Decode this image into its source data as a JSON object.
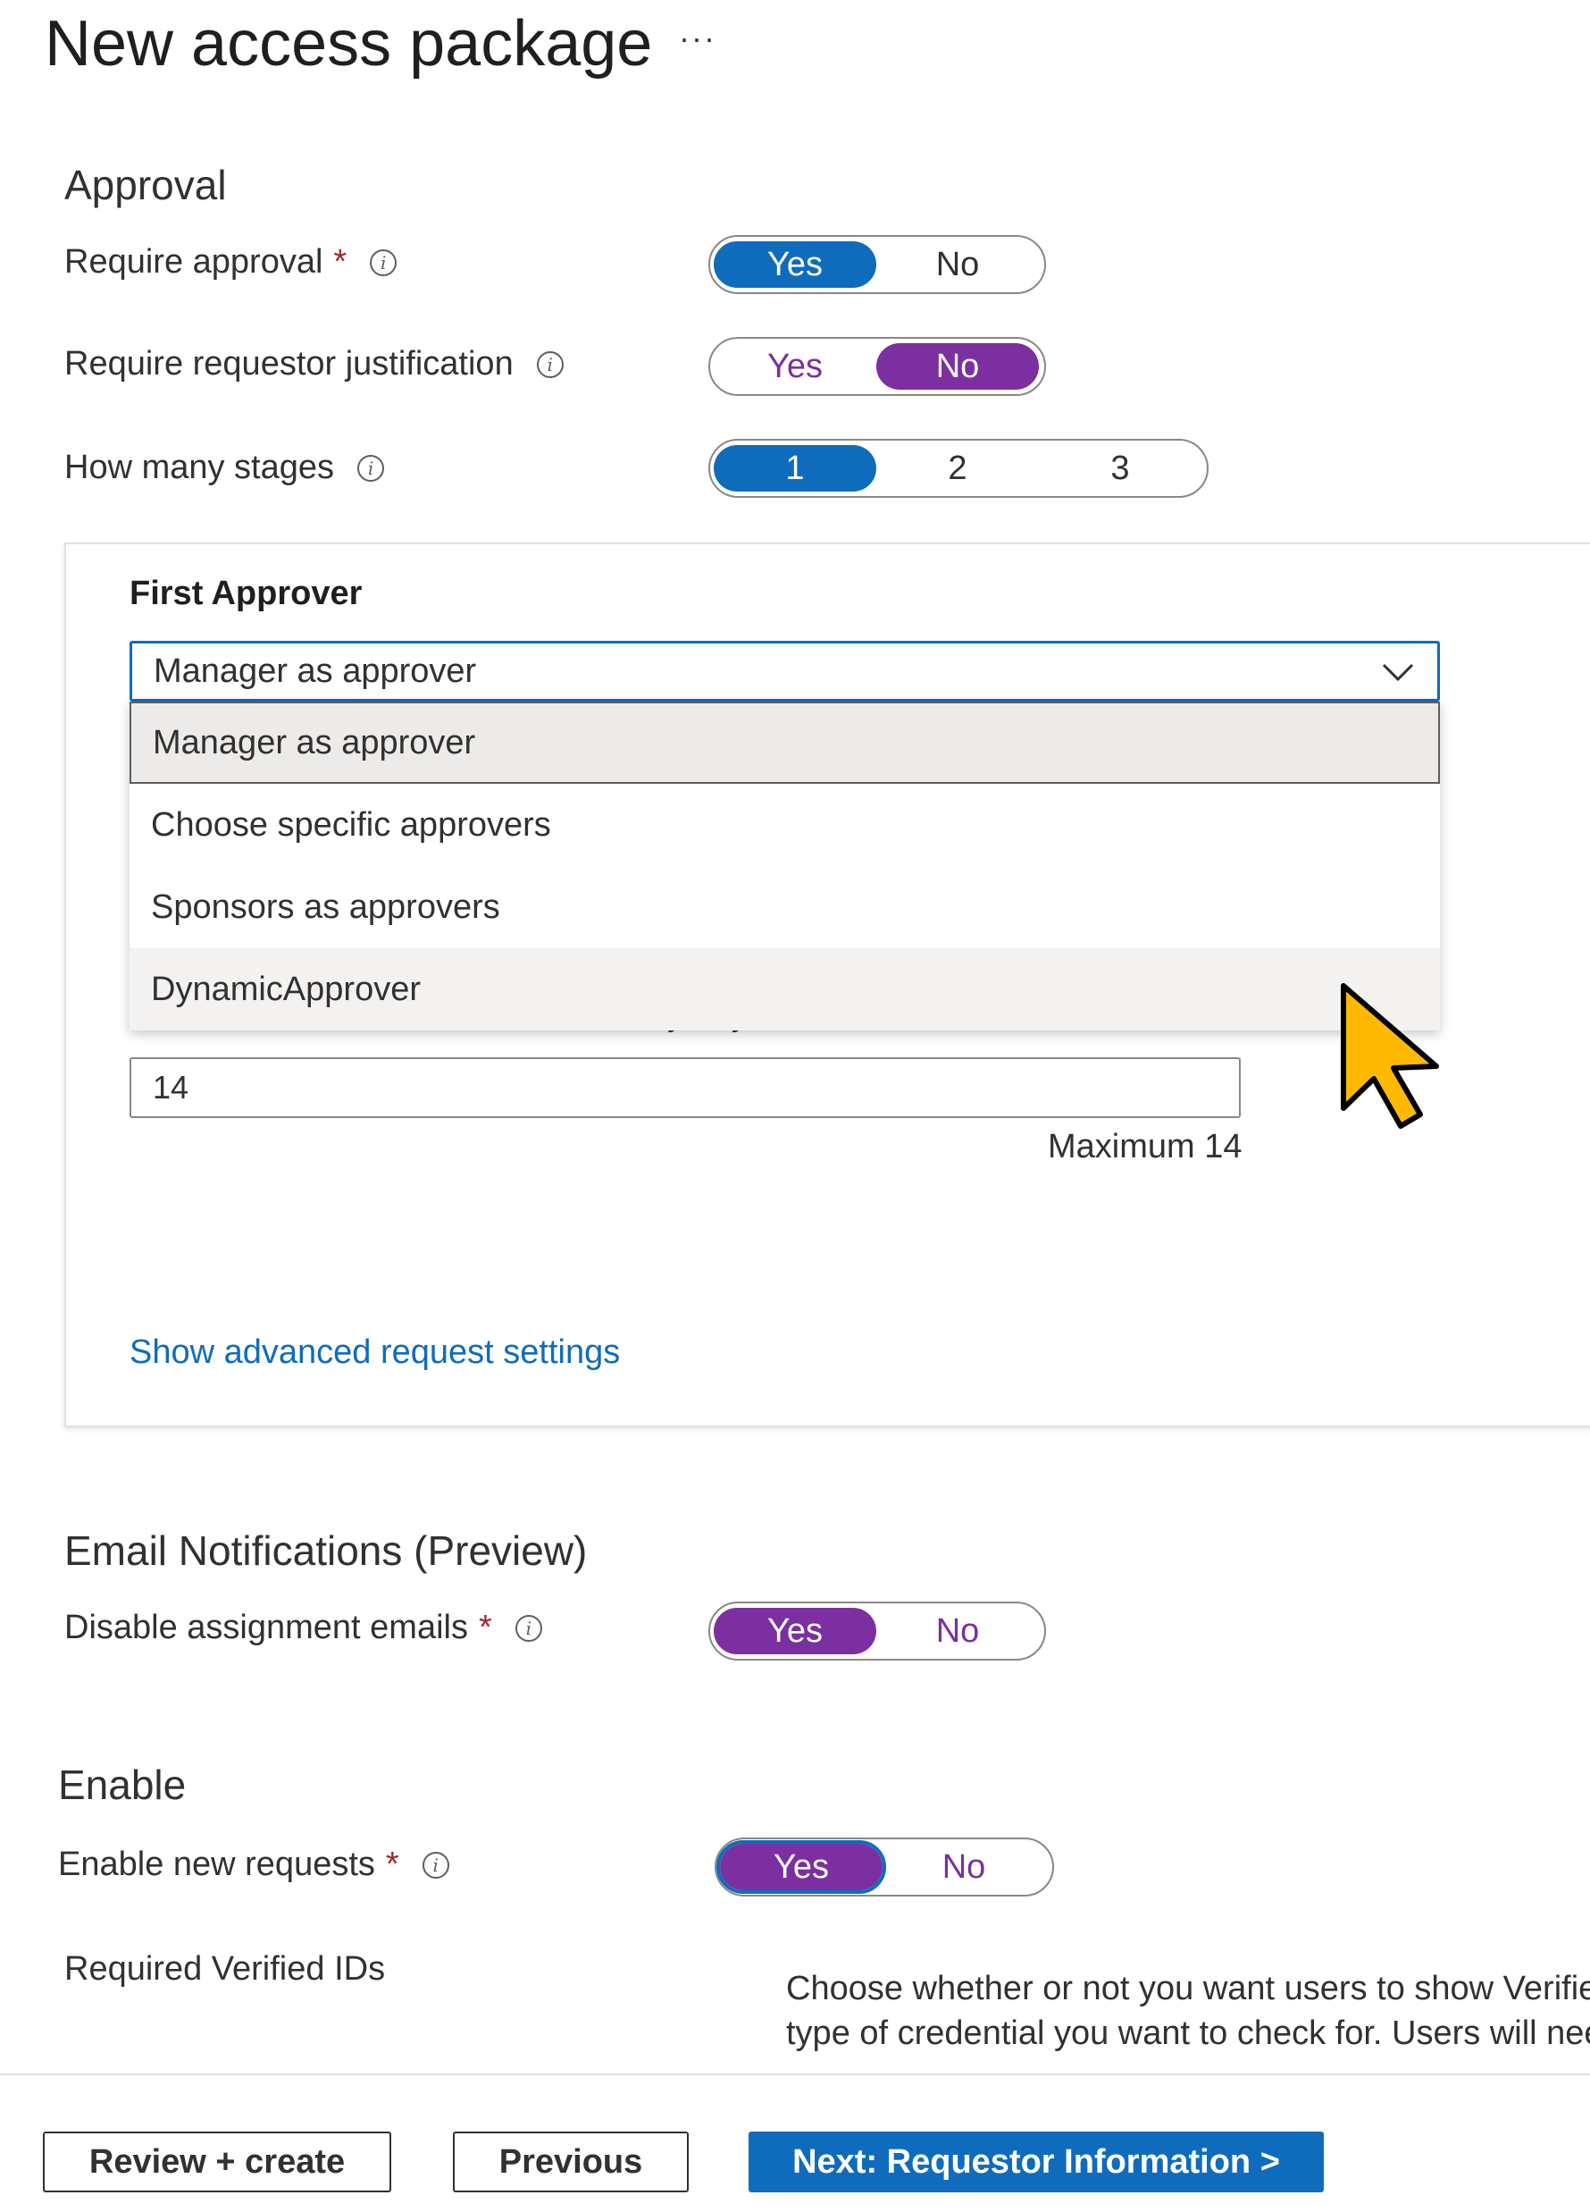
{
  "page": {
    "title": "New access package",
    "more_label": "···"
  },
  "approval": {
    "heading": "Approval",
    "require_approval": {
      "label": "Require approval",
      "required_mark": "*",
      "yes": "Yes",
      "no": "No",
      "selected": "Yes"
    },
    "require_justification": {
      "label": "Require requestor justification",
      "yes": "Yes",
      "no": "No",
      "selected": "No"
    },
    "stages": {
      "label": "How many stages",
      "options": [
        "1",
        "2",
        "3"
      ],
      "selected": "1"
    },
    "first_approver": {
      "label": "First Approver",
      "value": "Manager as approver",
      "options": [
        "Manager as approver",
        "Choose specific approvers",
        "Sponsors as approvers",
        "DynamicApprover"
      ],
      "selected_index": 0,
      "hovered_index": 3
    },
    "decision_days": {
      "label": "Decision must be made in how many days?",
      "value": "14",
      "max_text": "Maximum 14"
    },
    "advanced_link": "Show advanced request settings"
  },
  "email": {
    "heading": "Email Notifications (Preview)",
    "disable_emails": {
      "label": "Disable assignment emails",
      "required_mark": "*",
      "yes": "Yes",
      "no": "No",
      "selected": "Yes"
    }
  },
  "enable": {
    "heading": "Enable",
    "new_requests": {
      "label": "Enable new requests",
      "required_mark": "*",
      "yes": "Yes",
      "no": "No",
      "selected": "Yes"
    },
    "verified_ids": {
      "label": "Required Verified IDs",
      "hint_line1": "Choose whether or not you want users to show Verified",
      "hint_line2": "type of credential you want to check for. Users will nee"
    }
  },
  "footer": {
    "review_create": "Review + create",
    "previous": "Previous",
    "next": "Next: Requestor Information >"
  },
  "colors": {
    "primary_blue": "#0f6cbd",
    "purple": "#7b2fa0",
    "required_red": "#a4262c",
    "cursor_yellow": "#ffb900"
  },
  "icons": {
    "info": "info-icon",
    "chevron": "chevron-down-icon",
    "cursor": "mouse-pointer-icon"
  }
}
